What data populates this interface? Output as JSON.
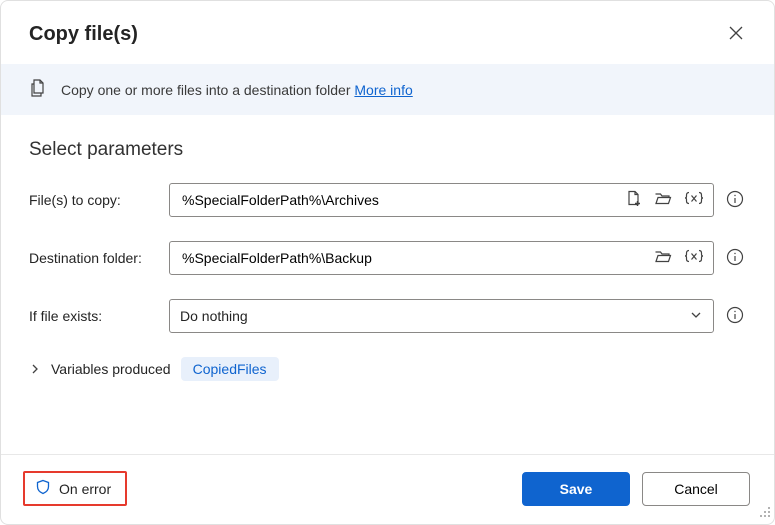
{
  "dialog": {
    "title": "Copy file(s)"
  },
  "banner": {
    "text": "Copy one or more files into a destination folder ",
    "link": "More info"
  },
  "section": {
    "title": "Select parameters"
  },
  "fields": {
    "filesToCopy": {
      "label": "File(s) to copy:",
      "value": "%SpecialFolderPath%\\Archives"
    },
    "destination": {
      "label": "Destination folder:",
      "value": "%SpecialFolderPath%\\Backup"
    },
    "ifExists": {
      "label": "If file exists:",
      "selected": "Do nothing"
    }
  },
  "variables": {
    "label": "Variables produced",
    "pill": "CopiedFiles"
  },
  "footer": {
    "onError": "On error",
    "save": "Save",
    "cancel": "Cancel"
  }
}
